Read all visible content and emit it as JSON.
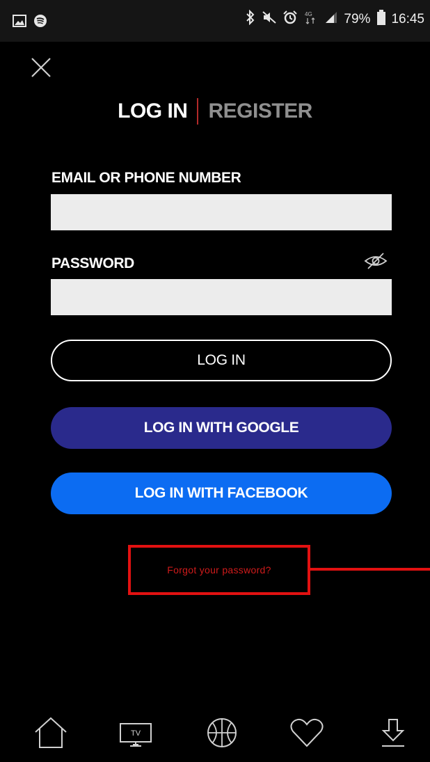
{
  "status_bar": {
    "battery": "79%",
    "time": "16:45",
    "left_icons": [
      "gallery-icon",
      "spotify-icon"
    ],
    "right_icons": [
      "bluetooth-icon",
      "mute-icon",
      "alarm-icon",
      "4g-icon",
      "signal-icon",
      "battery-icon"
    ]
  },
  "header": {
    "close_icon": "close-icon",
    "tab_login": "LOG IN",
    "tab_register": "REGISTER"
  },
  "form": {
    "email_label": "EMAIL OR PHONE NUMBER",
    "email_value": "",
    "password_label": "PASSWORD",
    "password_value": "",
    "password_toggle_icon": "eye-off-icon"
  },
  "buttons": {
    "login": "LOG IN",
    "google": "LOG IN WITH GOOGLE",
    "facebook": "LOG IN WITH FACEBOOK"
  },
  "forgot_password": "Forgot your password?",
  "bottom_nav": {
    "items": [
      {
        "icon": "home-icon"
      },
      {
        "icon": "tv-icon",
        "label": "TV"
      },
      {
        "icon": "basketball-icon"
      },
      {
        "icon": "heart-icon"
      },
      {
        "icon": "download-icon"
      }
    ]
  },
  "colors": {
    "background": "#000000",
    "google_button": "#2a2a8c",
    "facebook_button": "#0c6cf2",
    "tab_separator": "#b22a2a",
    "annotation": "#e21111"
  }
}
